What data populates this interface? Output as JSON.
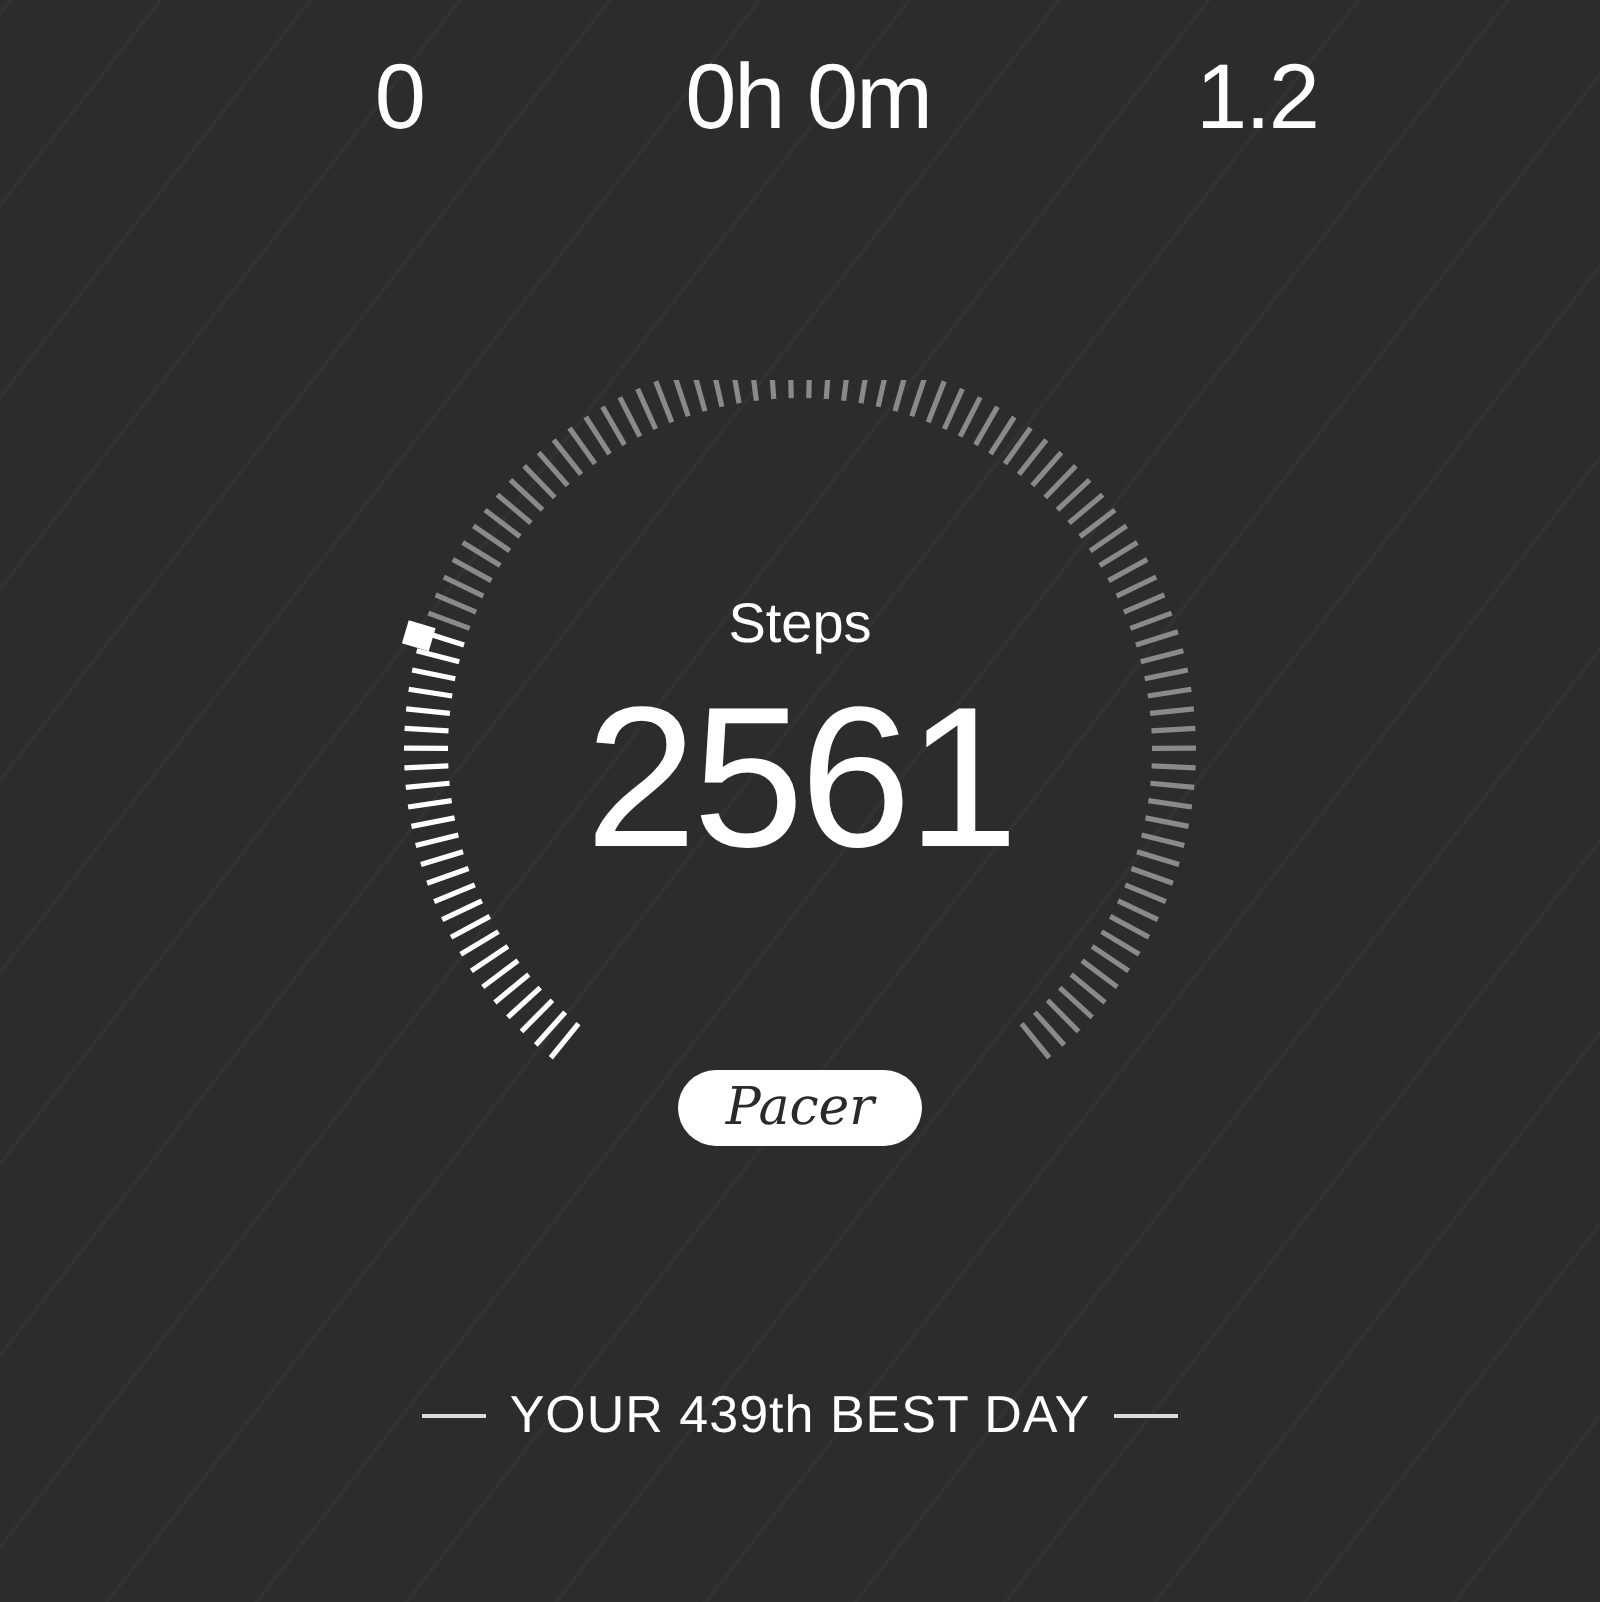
{
  "stats": [
    {
      "value": "0"
    },
    {
      "value": "0h 0m"
    },
    {
      "value": "1.2"
    }
  ],
  "steps": {
    "label": "Steps",
    "value": "2561"
  },
  "brand": "Pacer",
  "best_day": "YOUR 439th BEST DAY"
}
